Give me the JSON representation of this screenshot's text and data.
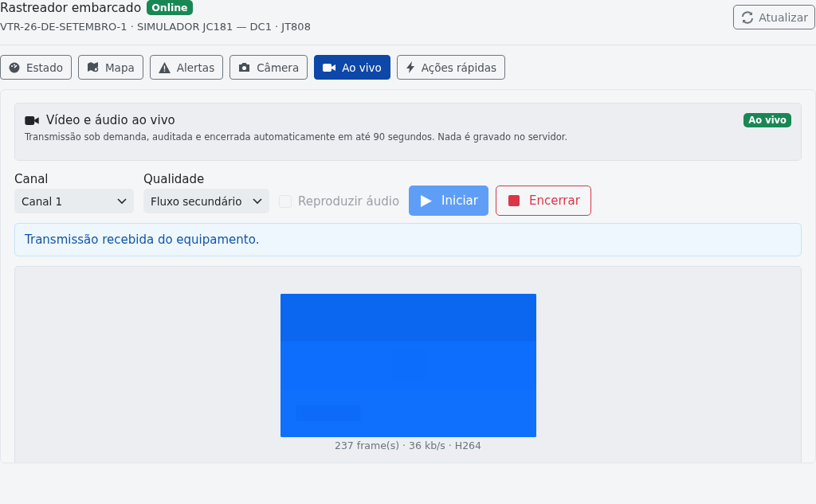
{
  "header": {
    "title": "Rastreador embarcado",
    "status_badge": "Online",
    "subtitle": "VTR-26-DE-SETEMBRO-1 · SIMULADOR JC181 — DC1 · JT808",
    "refresh_button": "Atualizar"
  },
  "tabs": [
    {
      "label": "Estado",
      "selected": false
    },
    {
      "label": "Mapa",
      "selected": false
    },
    {
      "label": "Alertas",
      "selected": false
    },
    {
      "label": "Câmera",
      "selected": false
    },
    {
      "label": "Ao vivo",
      "selected": true
    },
    {
      "label": "Ações rápidas",
      "selected": false
    }
  ],
  "live_panel": {
    "title": "Vídeo e áudio ao vivo",
    "badge": "Ao vivo",
    "description": "Transmissão sob demanda, auditada e encerrada automaticamente em até 90 segundos. Nada é gravado no servidor."
  },
  "controls": {
    "channel": {
      "label": "Canal",
      "value": "Canal 1"
    },
    "quality": {
      "label": "Qualidade",
      "value": "Fluxo secundário"
    },
    "audio": {
      "label": "Reproduzir áudio",
      "checked": false,
      "disabled": true
    },
    "start_button": {
      "label": "Iniciar",
      "disabled": true
    },
    "stop_button": {
      "label": "Encerrar"
    }
  },
  "info_message": "Transmissão recebida do equipamento.",
  "video": {
    "kind": "picture",
    "stats": "237 frame(s) · 36 kb/s · H264"
  }
}
